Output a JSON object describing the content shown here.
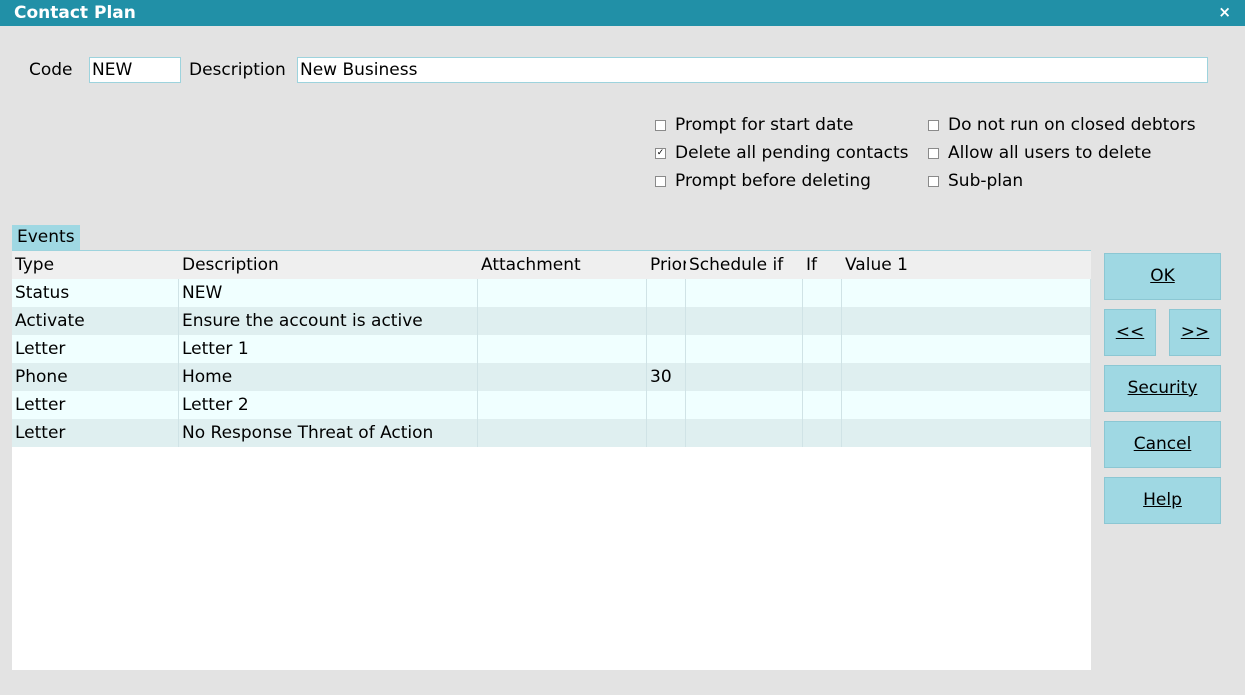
{
  "window": {
    "title": "Contact Plan",
    "close_glyph": "×"
  },
  "form": {
    "code_label": "Code",
    "code_value": "NEW",
    "description_label": "Description",
    "description_value": "New Business"
  },
  "options": [
    {
      "label": "Prompt for start date",
      "checked": false
    },
    {
      "label": "Delete all pending contacts",
      "checked": true
    },
    {
      "label": "Prompt before deleting",
      "checked": false
    },
    {
      "label": "Do not run on closed debtors",
      "checked": false
    },
    {
      "label": "Allow all users to delete",
      "checked": false
    },
    {
      "label": "Sub-plan",
      "checked": false
    }
  ],
  "events": {
    "tab_label": "Events",
    "columns": [
      "Type",
      "Description",
      "Attachment",
      "Prior",
      "Schedule if",
      "If",
      "Value 1"
    ],
    "rows": [
      [
        "Status",
        "NEW",
        "",
        "",
        "",
        "",
        ""
      ],
      [
        "Activate",
        "Ensure the account is active",
        "",
        "",
        "",
        "",
        ""
      ],
      [
        "Letter",
        "Letter 1",
        "",
        "",
        "",
        "",
        ""
      ],
      [
        "Phone",
        "Home",
        "",
        "30",
        "",
        "",
        ""
      ],
      [
        "Letter",
        "Letter 2",
        "",
        "",
        "",
        "",
        ""
      ],
      [
        "Letter",
        "No Response Threat of Action",
        "",
        "",
        "",
        "",
        ""
      ]
    ]
  },
  "buttons": {
    "ok": "OK",
    "prev": "<<",
    "next": ">>",
    "security": "Security",
    "cancel": "Cancel",
    "help": "Help"
  },
  "colors": {
    "titlebar": "#2190a7",
    "button": "#9fd8e3",
    "background": "#e3e3e3"
  }
}
